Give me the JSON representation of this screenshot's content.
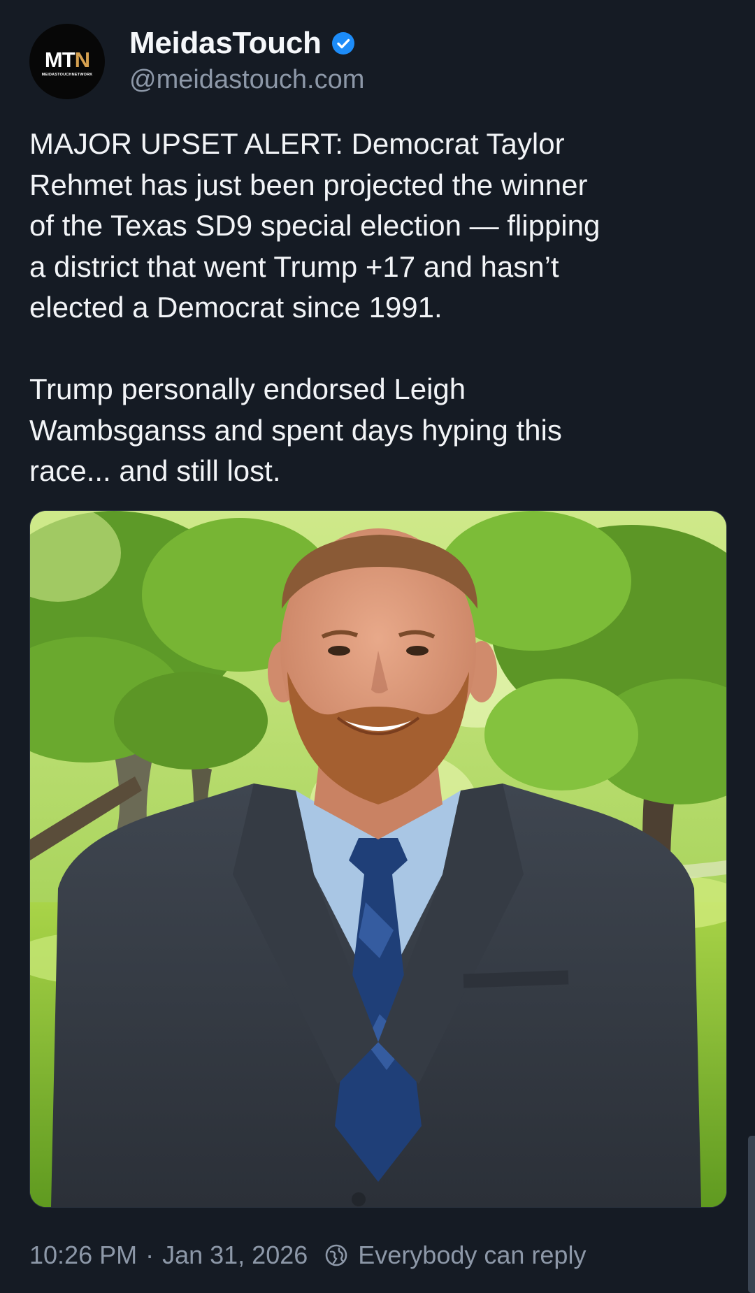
{
  "author": {
    "display_name": "MeidasTouch",
    "handle": "@meidastouch.com",
    "verified": true,
    "avatar": {
      "logo_main": "MT",
      "logo_accent": "N",
      "logo_sub": "MEIDASTOUCHNETWORK",
      "accent_color": "#d6a150"
    }
  },
  "post": {
    "text": "MAJOR UPSET ALERT: Democrat Taylor\nRehmet has just been projected the winner\nof the Texas SD9 special election — flipping\na district that went Trump +17 and hasn’t\nelected a Democrat since 1991.\n\nTrump personally endorsed Leigh\nWambsganss and spent days hyping this\nrace... and still lost.",
    "media": {
      "icon": "photo",
      "subject": "portrait"
    }
  },
  "footer": {
    "time": "10:26 PM",
    "separator": "·",
    "date": "Jan 31, 2026",
    "reply_setting": "Everybody can reply",
    "reply_icon": "globe-icon"
  },
  "colors": {
    "background": "#151b24",
    "text_primary": "#f2f4f7",
    "text_secondary": "#8d98a8",
    "verified_blue": "#1d8cf8"
  }
}
